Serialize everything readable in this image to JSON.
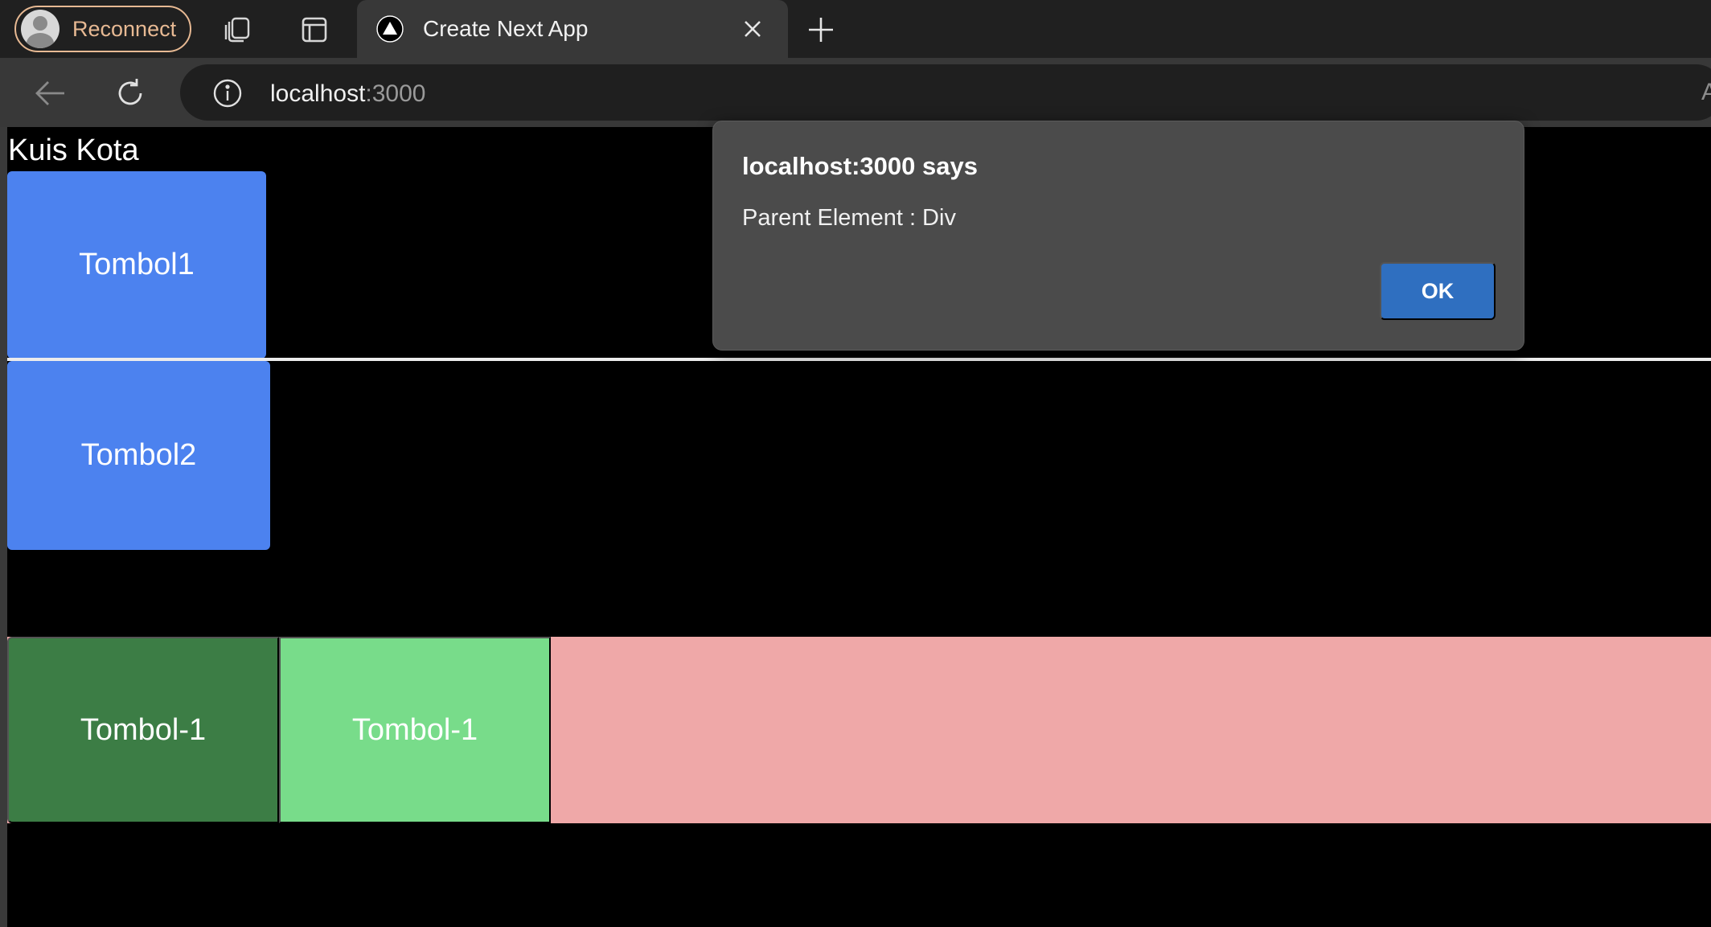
{
  "browser": {
    "profile_label": "Reconnect",
    "tab_title": "Create Next App",
    "url_host": "localhost",
    "url_port": ":3000"
  },
  "page": {
    "title": "Kuis Kota",
    "button1": "Tombol1",
    "button2": "Tombol2",
    "flex_button1": "Tombol-1",
    "flex_button2": "Tombol-1"
  },
  "dialog": {
    "title": "localhost:3000 says",
    "message": "Parent Element : Div",
    "ok_label": "OK"
  },
  "colors": {
    "blue_button": "#4c82ef",
    "dark_green_button": "#3c7d45",
    "light_green_button": "#78dc8a",
    "pink_container": "#efa8a8",
    "dialog_ok": "#2f6fc0",
    "profile_accent": "#e7b993"
  }
}
